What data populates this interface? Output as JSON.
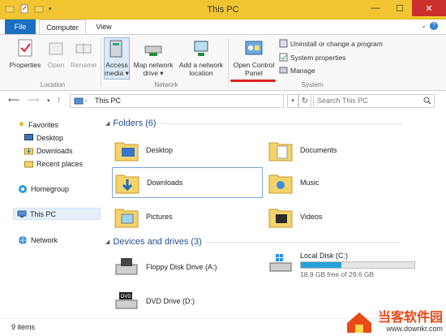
{
  "window": {
    "title": "This PC"
  },
  "window_controls": {
    "minimize": "—",
    "maximize": "☐",
    "close": "✕"
  },
  "ribbon_tabs": {
    "file": "File",
    "computer": "Computer",
    "view": "View"
  },
  "ribbon": {
    "location": {
      "properties": "Properties",
      "open": "Open",
      "rename": "Rename",
      "group": "Location"
    },
    "network": {
      "access_media_l1": "Access",
      "access_media_l2": "media",
      "map_drive_l1": "Map network",
      "map_drive_l2": "drive",
      "add_location_l1": "Add a network",
      "add_location_l2": "location",
      "group": "Network"
    },
    "system": {
      "control_panel_l1": "Open Control",
      "control_panel_l2": "Panel",
      "uninstall": "Uninstall or change a program",
      "system_properties": "System properties",
      "manage": "Manage",
      "group": "System"
    }
  },
  "address": {
    "path": "This PC",
    "search_placeholder": "Search This PC"
  },
  "nav": {
    "favorites": "Favorites",
    "desktop": "Desktop",
    "downloads": "Downloads",
    "recent": "Recent places",
    "homegroup": "Homegroup",
    "thispc": "This PC",
    "network": "Network"
  },
  "folders": {
    "header": "Folders (6)",
    "items": [
      "Desktop",
      "Documents",
      "Downloads",
      "Music",
      "Pictures",
      "Videos"
    ]
  },
  "drives": {
    "header": "Devices and drives (3)",
    "floppy": "Floppy Disk Drive (A:)",
    "local": {
      "name": "Local Disk (C:)",
      "free_text": "18.9 GB free of 29.6 GB",
      "used_fraction": 0.36
    },
    "dvd": "DVD Drive (D:)"
  },
  "status": {
    "count": "9 items"
  },
  "watermark": {
    "title": "当客软件园",
    "url": "www.downkr.com"
  },
  "colors": {
    "titlebar": "#f1c531",
    "file_tab": "#1a6fc0",
    "header_blue": "#1e4e8c",
    "drive_bar": "#26a0da",
    "highlight": "#e02020"
  }
}
